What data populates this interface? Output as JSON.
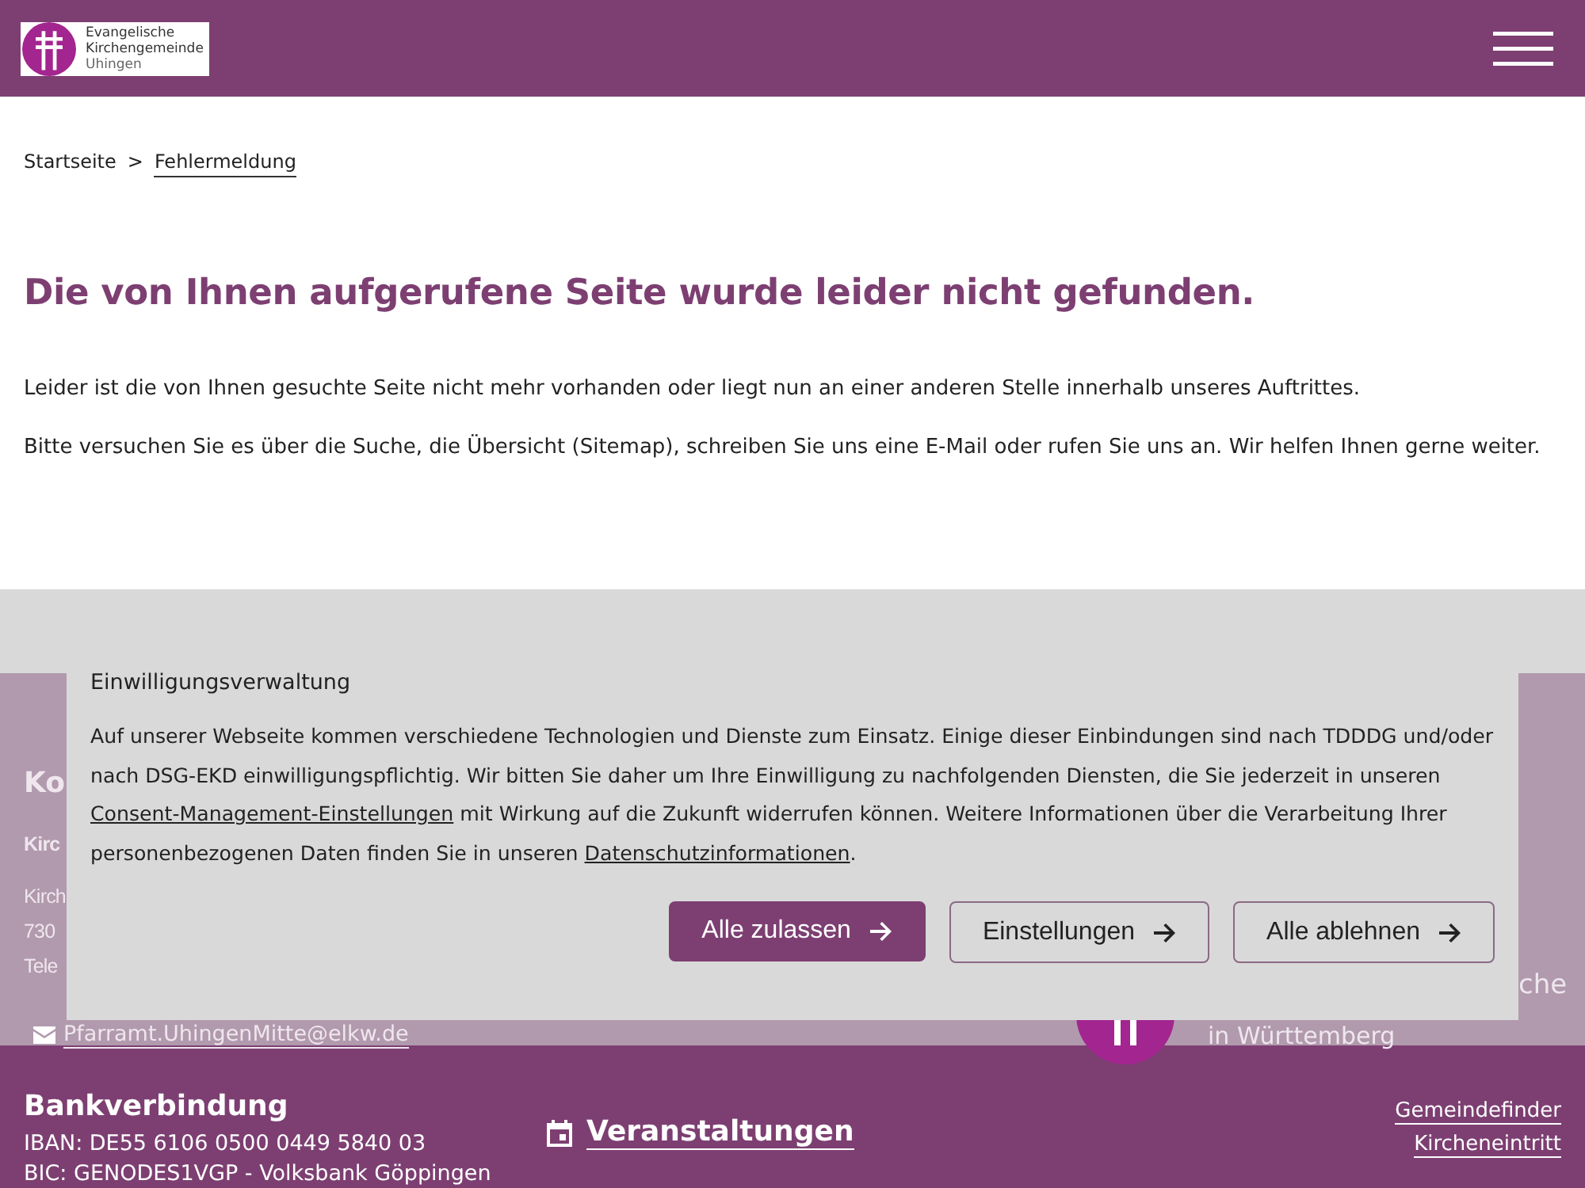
{
  "header": {
    "logo_lines": [
      "Evangelische",
      "Kirchengemeinde",
      "Uhingen"
    ]
  },
  "breadcrumb": {
    "separator": ">",
    "items": [
      {
        "label": "Startseite",
        "selected": false
      },
      {
        "label": "Fehlermeldung",
        "selected": true
      }
    ]
  },
  "heading": "Die von Ihnen aufgerufene Seite wurde leider nicht gefunden.",
  "paragraphs": [
    "Leider ist die von Ihnen gesuchte Seite nicht mehr vorhanden oder liegt nun an einer anderen Stelle innerhalb unseres Auftrittes.",
    "Bitte versuchen Sie es über die Suche, die Übersicht (Sitemap), schreiben Sie uns eine E-Mail oder rufen Sie uns an. Wir helfen Ihnen gerne weiter."
  ],
  "footer_behind": {
    "contact_title": "Ko",
    "contact_name": "Kirc",
    "contact_lines": [
      "Kirch",
      "730",
      "Tele"
    ],
    "email": "Pfarramt.UhingenMitte@elkw.de",
    "church_lines": [
      "che",
      "in Württemberg"
    ]
  },
  "bank": {
    "title": "Bankverbindung",
    "lines": [
      "IBAN: DE55 6106 0500 0449 5840 03",
      "BIC: GENODES1VGP - Volksbank Göppingen"
    ]
  },
  "events_link": "Veranstaltungen",
  "links": [
    "Gemeindefinder",
    "Kircheneintritt"
  ],
  "consent": {
    "title": "Einwilligungsverwaltung",
    "text": [
      {
        "kind": "text",
        "text": "Auf unserer Webseite kommen verschiedene Technologien und Dienste zum Einsatz. Einige dieser Einbindungen sind nach TDDDG und/oder nach DSG-EKD einwilligungspflichtig. Wir bitten Sie daher um Ihre Einwilligung zu nachfolgenden Diensten, die Sie jederzeit in unseren "
      },
      {
        "kind": "link",
        "text": "Consent-Management-Einstellungen"
      },
      {
        "kind": "text",
        "text": " mit Wirkung auf die Zukunft widerrufen können. Weitere Informationen über die Verarbeitung Ihrer personenbezogenen Daten finden Sie in unseren "
      },
      {
        "kind": "link",
        "text": "Datenschutzinformationen"
      },
      {
        "kind": "text",
        "text": "."
      }
    ],
    "buttons": [
      {
        "label": "Alle zulassen",
        "kind": "primary"
      },
      {
        "label": "Einstellungen",
        "kind": "secondary"
      },
      {
        "label": "Alle ablehnen",
        "kind": "secondary"
      }
    ]
  }
}
